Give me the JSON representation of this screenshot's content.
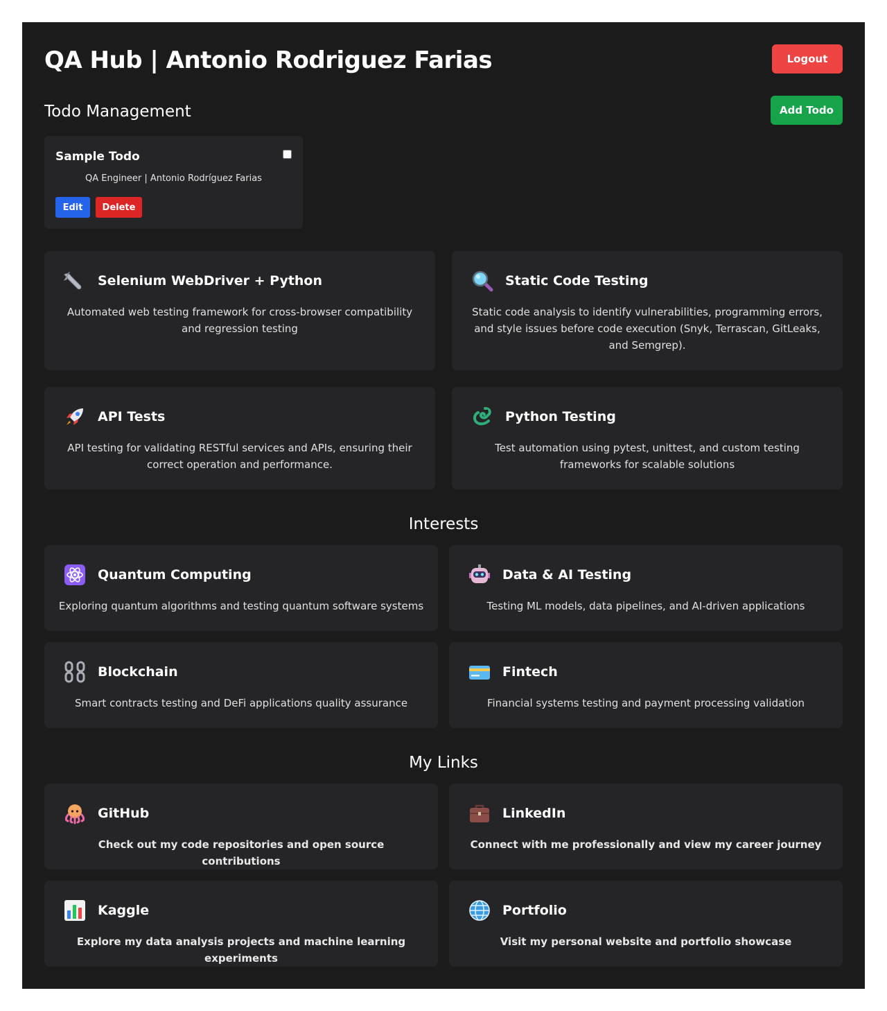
{
  "header": {
    "title": "QA Hub | Antonio Rodriguez Farias",
    "logout_label": "Logout"
  },
  "todo_section": {
    "title": "Todo Management",
    "add_label": "Add Todo",
    "todos": [
      {
        "title": "Sample Todo",
        "description": "QA Engineer | Antonio Rodríguez Farias",
        "completed": false,
        "edit_label": "Edit",
        "delete_label": "Delete"
      }
    ]
  },
  "skills": [
    {
      "icon": "wrench-icon",
      "title": "Selenium WebDriver + Python",
      "description": "Automated web testing framework for cross-browser compatibility and regression testing"
    },
    {
      "icon": "magnifying-glass-icon",
      "title": "Static Code Testing",
      "description": "Static code analysis to identify vulnerabilities, programming errors, and style issues before code execution (Snyk, Terrascan, GitLeaks, and Semgrep)."
    },
    {
      "icon": "rocket-icon",
      "title": "API Tests",
      "description": "API testing for validating RESTful services and APIs, ensuring their correct operation and performance."
    },
    {
      "icon": "snake-icon",
      "title": "Python Testing",
      "description": "Test automation using pytest, unittest, and custom testing frameworks for scalable solutions"
    }
  ],
  "interests": {
    "heading": "Interests",
    "items": [
      {
        "icon": "atom-icon",
        "title": "Quantum Computing",
        "description": "Exploring quantum algorithms and testing quantum software systems"
      },
      {
        "icon": "robot-icon",
        "title": "Data & AI Testing",
        "description": "Testing ML models, data pipelines, and AI-driven applications"
      },
      {
        "icon": "chain-icon",
        "title": "Blockchain",
        "description": "Smart contracts testing and DeFi applications quality assurance"
      },
      {
        "icon": "credit-card-icon",
        "title": "Fintech",
        "description": "Financial systems testing and payment processing validation"
      }
    ]
  },
  "links": {
    "heading": "My Links",
    "items": [
      {
        "icon": "octopus-icon",
        "title": "GitHub",
        "description": "Check out my code repositories and open source contributions"
      },
      {
        "icon": "briefcase-icon",
        "title": "LinkedIn",
        "description": "Connect with me professionally and view my career journey"
      },
      {
        "icon": "bar-chart-icon",
        "title": "Kaggle",
        "description": "Explore my data analysis projects and machine learning experiments"
      },
      {
        "icon": "globe-icon",
        "title": "Portfolio",
        "description": "Visit my personal website and portfolio showcase"
      }
    ]
  },
  "colors": {
    "background": "#1b1b1b",
    "card": "#252528",
    "logout": "#ef4444",
    "add": "#16a34a",
    "edit": "#2563eb",
    "delete": "#dc2626"
  }
}
